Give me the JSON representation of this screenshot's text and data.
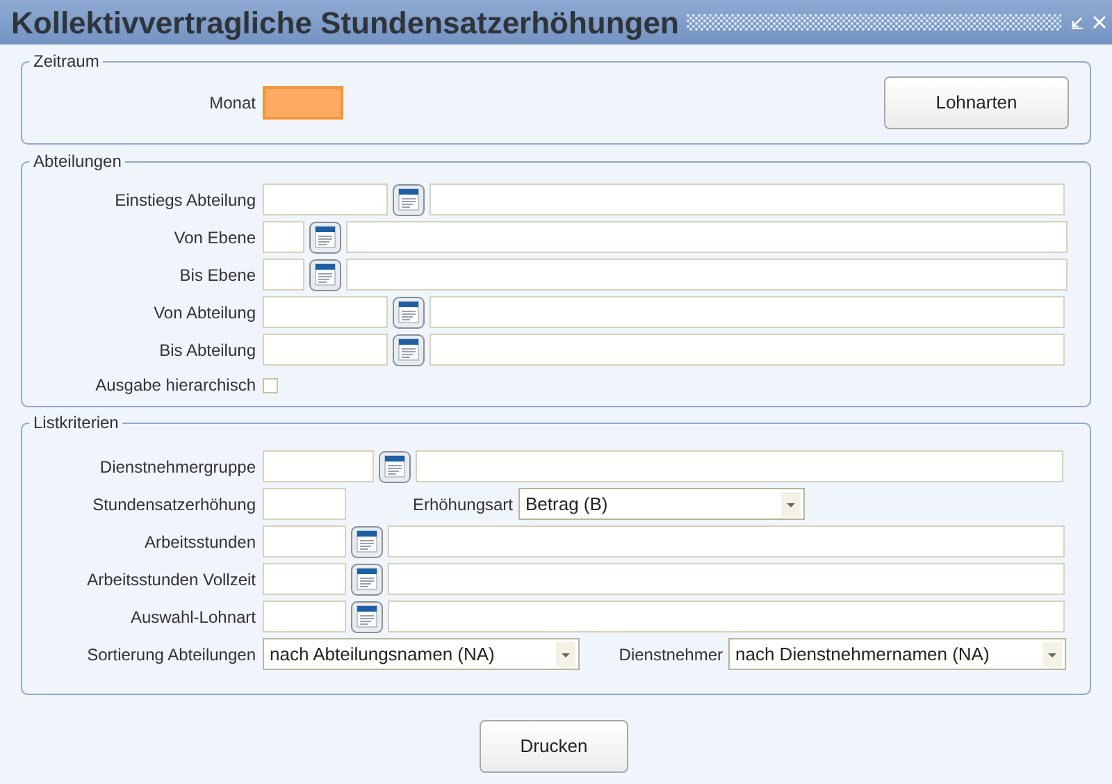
{
  "window": {
    "title": "Kollektivvertragliche Stundensatzerhöhungen"
  },
  "zeitraum": {
    "legend": "Zeitraum",
    "month_label": "Monat",
    "month_focused": true,
    "button": "Lohnarten"
  },
  "abteilungen": {
    "legend": "Abteilungen",
    "rows": [
      {
        "kind": "lookup-wide",
        "label": "Einstiegs Abteilung"
      },
      {
        "kind": "lookup-narrow",
        "label": "Von Ebene"
      },
      {
        "kind": "lookup-narrow",
        "label": "Bis Ebene"
      },
      {
        "kind": "lookup-wide",
        "label": "Von Abteilung"
      },
      {
        "kind": "lookup-wide",
        "label": "Bis Abteilung"
      },
      {
        "kind": "checkbox",
        "label": "Ausgabe hierarchisch",
        "checked": false
      }
    ]
  },
  "listkriterien": {
    "legend": "Listkriterien",
    "rows": [
      {
        "kind": "lookup-medium",
        "label": "Dienstnehmergruppe"
      },
      {
        "kind": "text-select",
        "label": "Stundensatzerhöhung",
        "select_label": "Erhöhungsart",
        "select_value": "Betrag (B)"
      },
      {
        "kind": "lookup-small",
        "label": "Arbeitsstunden"
      },
      {
        "kind": "lookup-small",
        "label": "Arbeitsstunden Vollzeit"
      },
      {
        "kind": "lookup-small",
        "label": "Auswahl-Lohnart"
      },
      {
        "kind": "select-pair",
        "label": "Sortierung Abteilungen",
        "value": "nach Abteilungsnamen (NA)",
        "select_label": "Dienstnehmer",
        "select_value": "nach Dienstnehmernamen (NA)"
      }
    ]
  },
  "print_button": "Drucken"
}
